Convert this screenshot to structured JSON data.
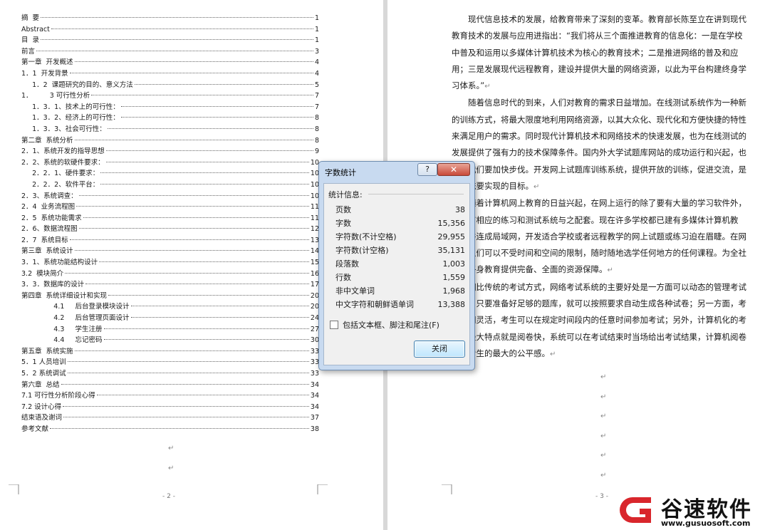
{
  "toc": [
    {
      "text": "摘  要",
      "page": "1"
    },
    {
      "text": "Abstract",
      "page": "1"
    },
    {
      "text": "目  录",
      "page": "1"
    },
    {
      "text": "前言",
      "page": "3"
    },
    {
      "text": "第一章  开发概述",
      "page": "4"
    },
    {
      "text": "1．1  开发背景",
      "page": "4"
    },
    {
      "text": "     1．2  课题研究的目的、意义方法",
      "page": "5"
    },
    {
      "text": "1．        3 可行性分析",
      "page": "7"
    },
    {
      "text": "     1．3．1、技术上的可行性：",
      "page": "7"
    },
    {
      "text": "     1．3．2、经济上的可行性：",
      "page": "8"
    },
    {
      "text": "     1．3．3、社会可行性：",
      "page": "8"
    },
    {
      "text": "第二章  系统分析",
      "page": "8"
    },
    {
      "text": "2．1、系统开发的指导思想",
      "page": "9"
    },
    {
      "text": "2．2、系统的软硬件要求：",
      "page": "10"
    },
    {
      "text": "     2．2．1、硬件要求：",
      "page": "10"
    },
    {
      "text": "     2．2．2、软件平台：",
      "page": "10"
    },
    {
      "text": "2．3、系统调查：",
      "page": "10"
    },
    {
      "text": "2．4  业务流程图",
      "page": "11"
    },
    {
      "text": "2．5  系统功能需求",
      "page": "11"
    },
    {
      "text": "2．6、数据流程图",
      "page": "12"
    },
    {
      "text": "2．7  系统目标",
      "page": "13"
    },
    {
      "text": "第三章  系统设计",
      "page": "14"
    },
    {
      "text": "3．1、系统功能结构设计",
      "page": "15"
    },
    {
      "text": "3.2  模块简介",
      "page": "16"
    },
    {
      "text": "3．3．数据库的设计",
      "page": "17"
    },
    {
      "text": "第四章  系统详细设计和实现",
      "page": "20"
    },
    {
      "text": "               4.1     后台登录模块设计",
      "page": "20"
    },
    {
      "text": "               4.2     后台管理页面设计",
      "page": "24"
    },
    {
      "text": "               4.3     学生注册",
      "page": "27"
    },
    {
      "text": "               4.4     忘记密码",
      "page": "30"
    },
    {
      "text": "第五章  系统实施",
      "page": "33"
    },
    {
      "text": "5．1 人员培训",
      "page": "33"
    },
    {
      "text": "5．2 系统调试",
      "page": "33"
    },
    {
      "text": "第六章  总结",
      "page": "34"
    },
    {
      "text": "7.1 可行性分析阶段心得",
      "page": "34"
    },
    {
      "text": "7.2 设计心得",
      "page": "34"
    },
    {
      "text": "结束语及谢词",
      "page": "37"
    },
    {
      "text": "参考文献",
      "page": "38"
    }
  ],
  "left_page_number": "- 2 -",
  "right_page_number": "- 3 -",
  "paragraph_mark": "↵",
  "body_paragraphs": [
    "现代信息技术的发展，给教育带来了深刻的变革。教育部长陈至立在讲到现代教育技术的发展与应用进指出：“我们将从三个面推进教育的信息化：一是在学校中普及和运用以多媒体计算机技术为核心的教育技术；二是推进网络的普及和应用；三是发展现代远程教育，建设并提供大量的网络资源，以此为平台构建终身学习体系。”",
    "随着信息时代的到来，人们对教育的需求日益增加。在线测试系统作为一种新的训练方式，将最大限度地利用网络资源，以其大众化、现代化和方便快捷的特性来满足用户的需求。同时现代计算机技术和网络技术的快速发展，也为在线测试的发展提供了强有力的技术保障条件。国内外大学试题库网站的成功运行和兴起，也促使我们要加快步伐。开发网上试题库训练系统，提供开放的训练，促进交流，是本系统要实现的目标。",
    "随着计算机网上教育的日益兴起，在网上运行的除了要有大量的学习软件外，还要有相应的练习和测试系统与之配套。现在许多学校都已建有多媒体计算机教室，并连成局域网，开发适合学校或者远程教学的网上试题或练习迫在眉睫。在网上，人们可以不受时间和空间的限制，随时随地选学任何地方的任何课程。为全社会的终身教育提供完备、全面的资源保障。",
    "相比传统的考试方式，网络考试系统的主要好处是一方面可以动态的管理考试信息，只要准备好足够的题库，就可以按照要求自动生成各种试卷；另一方面，考试时间灵活，考生可以在规定时间段内的任意时间参加考试；另外，计算机化的考试的最大特点就是阅卷快，系统可以在考试结束时当场给出考试结果，计算机阅卷给了考生的最大的公平感。"
  ],
  "dialog": {
    "title": "字数统计",
    "help_label": "?",
    "close_label": "✕",
    "section_label": "统计信息:",
    "stats": [
      {
        "label": "页数",
        "value": "38"
      },
      {
        "label": "字数",
        "value": "15,356"
      },
      {
        "label": "字符数(不计空格)",
        "value": "29,955"
      },
      {
        "label": "字符数(计空格)",
        "value": "35,131"
      },
      {
        "label": "段落数",
        "value": "1,003"
      },
      {
        "label": "行数",
        "value": "1,559"
      },
      {
        "label": "非中文单词",
        "value": "1,968"
      },
      {
        "label": "中文字符和朝鲜语单词",
        "value": "13,388"
      }
    ],
    "checkbox_label": "包括文本框、脚注和尾注(F)",
    "checkbox_checked": false,
    "button_label": "关闭"
  },
  "watermark": {
    "brand": "谷速软件",
    "url": "www.gusuosoft.com",
    "accent": "#d9262c"
  }
}
